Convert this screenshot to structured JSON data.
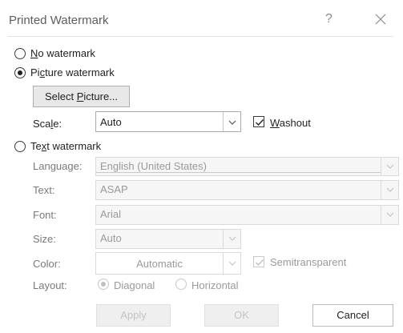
{
  "dialog": {
    "title": "Printed Watermark",
    "help_label": "?",
    "close_icon": "close-icon"
  },
  "no_watermark": {
    "label_prefix": "",
    "mnemonic": "N",
    "label_rest": "o watermark",
    "selected": false
  },
  "picture_watermark": {
    "label_prefix": "Pi",
    "mnemonic": "c",
    "label_rest": "ture watermark",
    "selected": true
  },
  "select_picture": {
    "label_prefix": "Select ",
    "mnemonic": "P",
    "label_rest": "icture..."
  },
  "scale": {
    "label_prefix": "Sca",
    "mnemonic": "l",
    "label_rest": "e:",
    "value": "Auto"
  },
  "washout": {
    "label_prefix": "",
    "mnemonic": "W",
    "label_rest": "ashout",
    "checked": true
  },
  "text_watermark": {
    "label_prefix": "Te",
    "mnemonic": "x",
    "label_rest": "t watermark",
    "selected": false
  },
  "language": {
    "label": "Language:",
    "value": "English (United States)"
  },
  "text": {
    "label": "Text:",
    "value": "ASAP"
  },
  "font": {
    "label": "Font:",
    "value": "Arial"
  },
  "size": {
    "label": "Size:",
    "value": "Auto"
  },
  "color": {
    "label": "Color:",
    "value": "Automatic"
  },
  "semitransparent": {
    "label": "Semitransparent",
    "checked": true
  },
  "layout": {
    "label": "Layout:",
    "diagonal": "Diagonal",
    "horizontal": "Horizontal",
    "selected": "Diagonal"
  },
  "buttons": {
    "apply": "Apply",
    "ok": "OK",
    "cancel": "Cancel"
  }
}
